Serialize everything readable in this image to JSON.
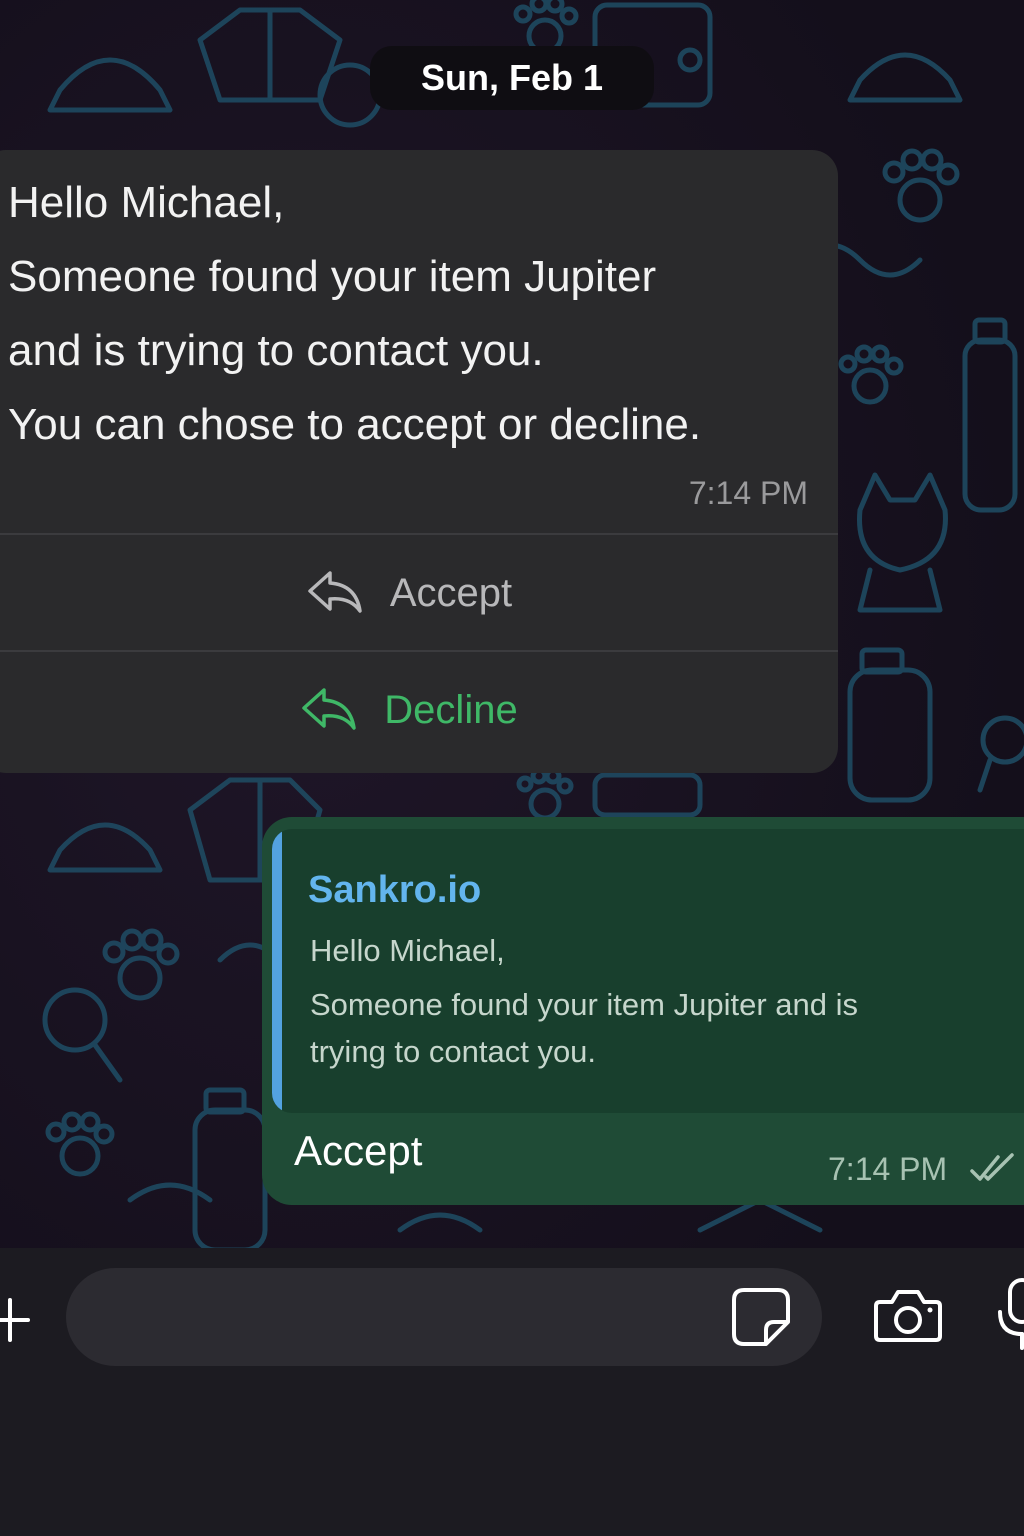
{
  "chat": {
    "date_label": "Sun, Feb 1"
  },
  "incoming_message": {
    "lines": [
      "Hello Michael,",
      "Someone found your item Jupiter",
      "and is trying to contact you.",
      "You can chose to accept or decline."
    ],
    "time": "7:14 PM",
    "buttons": {
      "accept_label": "Accept",
      "decline_label": "Decline"
    }
  },
  "outgoing_message": {
    "quote": {
      "sender": "Sankro.io",
      "lines": [
        "Hello Michael,",
        "Someone found your item Jupiter and is",
        "trying to contact you."
      ]
    },
    "text": "Accept",
    "time": "7:14 PM",
    "status_icon": "double-check-icon"
  },
  "composer": {
    "placeholder": "",
    "icons": [
      "plus-icon",
      "sticker-icon",
      "camera-icon",
      "microphone-icon"
    ]
  },
  "colors": {
    "incoming_bubble": "#2a2a2c",
    "outgoing_bubble": "#1f4b36",
    "accept_text": "#b8b8ba",
    "decline_text": "#3fb867",
    "quote_bar": "#53a2e0",
    "quote_sender": "#63b5ee"
  }
}
